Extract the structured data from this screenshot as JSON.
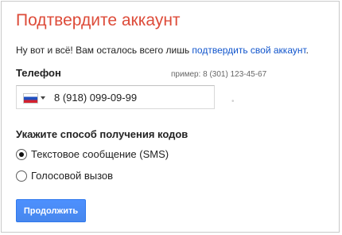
{
  "page": {
    "title": "Подтвердите аккаунт",
    "intro_text": "Ну вот и всё! Вам осталось всего лишь ",
    "intro_link": "подтвердить свой аккаунт",
    "intro_end": "."
  },
  "phone": {
    "label": "Телефон",
    "example": "пример: 8 (301) 123-45-67",
    "country_flag": "russia-flag-icon",
    "value": "8 (918) 099-09-99"
  },
  "delivery": {
    "label": "Укажите способ получения кодов",
    "options": [
      {
        "label": "Текстовое сообщение (SMS)",
        "selected": true
      },
      {
        "label": "Голосовой вызов",
        "selected": false
      }
    ]
  },
  "actions": {
    "continue_label": "Продолжить"
  },
  "colors": {
    "title": "#dd4b39",
    "link": "#1155cc",
    "button": "#4d90fe"
  }
}
